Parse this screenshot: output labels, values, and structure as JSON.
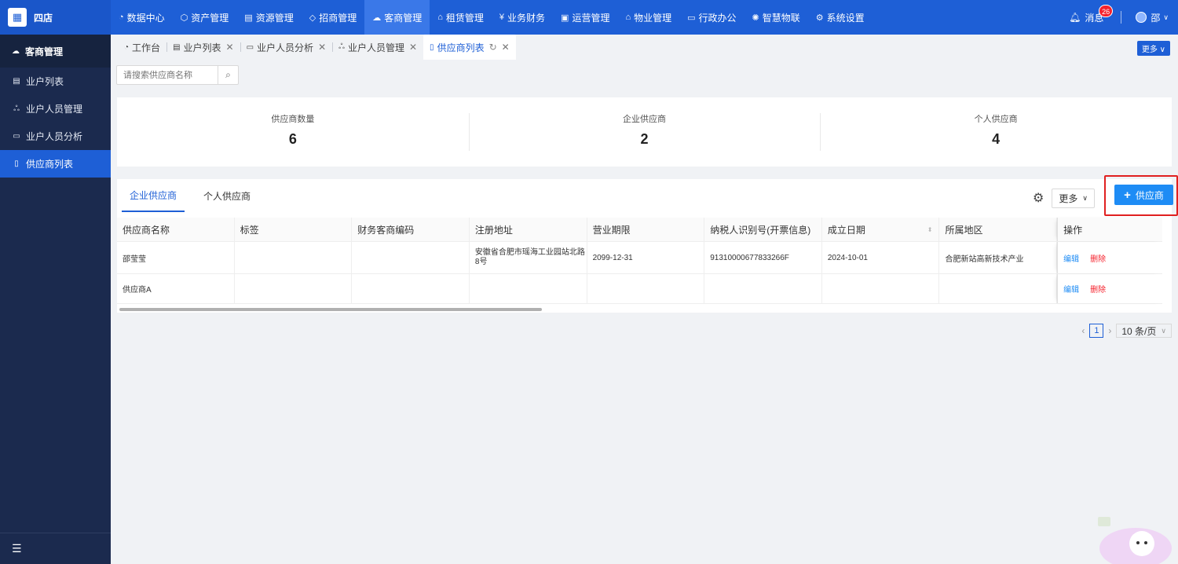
{
  "app": {
    "logo_char": "▦",
    "name": "四店"
  },
  "nav": [
    {
      "icon": "◔",
      "label": "数据中心"
    },
    {
      "icon": "⬡",
      "label": "资产管理"
    },
    {
      "icon": "▤",
      "label": "资源管理"
    },
    {
      "icon": "◇",
      "label": "招商管理"
    },
    {
      "icon": "☁",
      "label": "客商管理"
    },
    {
      "icon": "⌂",
      "label": "租赁管理"
    },
    {
      "icon": "¥",
      "label": "业务财务"
    },
    {
      "icon": "▣",
      "label": "运营管理"
    },
    {
      "icon": "⌂",
      "label": "物业管理"
    },
    {
      "icon": "▭",
      "label": "行政办公"
    },
    {
      "icon": "✺",
      "label": "智慧物联"
    },
    {
      "icon": "⚙",
      "label": "系统设置"
    }
  ],
  "header": {
    "messages_label": "消息",
    "messages_count": "26",
    "user_name": "邵"
  },
  "sidebar": {
    "title": "客商管理",
    "items": [
      {
        "label": "业户列表"
      },
      {
        "label": "业户人员管理"
      },
      {
        "label": "业户人员分析"
      },
      {
        "label": "供应商列表"
      }
    ]
  },
  "tabs": [
    {
      "label": "工作台"
    },
    {
      "label": "业户列表"
    },
    {
      "label": "业户人员分析"
    },
    {
      "label": "业户人员管理"
    },
    {
      "label": "供应商列表"
    }
  ],
  "tabs_more": "更多",
  "search": {
    "placeholder": "请搜索供应商名称"
  },
  "stats": [
    {
      "label": "供应商数量",
      "value": "6"
    },
    {
      "label": "企业供应商",
      "value": "2"
    },
    {
      "label": "个人供应商",
      "value": "4"
    }
  ],
  "panel_tabs": [
    "企业供应商",
    "个人供应商"
  ],
  "toolbar": {
    "more": "更多",
    "add": "供应商"
  },
  "table": {
    "columns": [
      "供应商名称",
      "标签",
      "财务客商编码",
      "注册地址",
      "营业期限",
      "纳税人识别号(开票信息)",
      "成立日期",
      "所属地区",
      "操作"
    ],
    "rows": [
      {
        "name": "邵莹莹",
        "tag": "",
        "code": "",
        "address": "安徽省合肥市瑶海工业园站北路8号",
        "term": "2099-12-31",
        "tax": "91310000677833266F",
        "date": "2024-10-01",
        "region": "合肥新站高新技术产业"
      },
      {
        "name": "供应商A",
        "tag": "",
        "code": "",
        "address": "",
        "term": "",
        "tax": "",
        "date": "",
        "region": ""
      }
    ],
    "edit": "编辑",
    "delete": "删除"
  },
  "pagination": {
    "page": "1",
    "page_size": "10 条/页"
  }
}
